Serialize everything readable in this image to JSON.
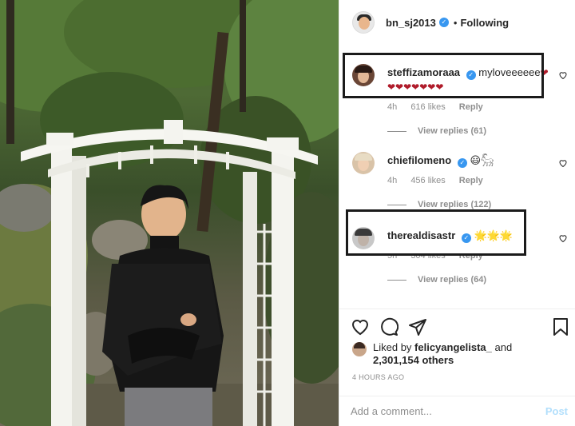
{
  "post": {
    "header": {
      "username": "bn_sj2013",
      "separator": "•",
      "follow_status": "Following",
      "verified_glyph": "✓"
    },
    "comments": [
      {
        "username": "steffizamoraaa",
        "text": "myloveeeeee",
        "trail_emoji": "❤",
        "second_line": "❤❤❤❤❤❤❤",
        "time": "4h",
        "likes": "616 likes",
        "reply": "Reply",
        "view_replies": "View replies (61)",
        "verified": true,
        "highlighted": true
      },
      {
        "username": "chiefilomeno",
        "text": "😃𓃵",
        "time": "4h",
        "likes": "456 likes",
        "reply": "Reply",
        "view_replies": "View replies (122)",
        "verified": true,
        "highlighted": false
      },
      {
        "username": "therealdisastr",
        "text": "🌟🌟🌟",
        "time": "5h",
        "likes": "304 likes",
        "reply": "Reply",
        "view_replies": "View replies (64)",
        "verified": true,
        "highlighted": true
      }
    ],
    "actions": {
      "icons": [
        "heart-icon",
        "comment-icon",
        "share-icon",
        "bookmark-icon"
      ]
    },
    "likes": {
      "prefix": "Liked by",
      "first_liker": "felicyangelista_",
      "conjunction": "and",
      "others_count": "2,301,154 others"
    },
    "timestamp": "4 HOURS AGO",
    "add_comment": {
      "placeholder": "Add a comment...",
      "post_label": "Post"
    }
  },
  "colors": {
    "verified": "#3897f0",
    "muted_text": "#8e8e8e",
    "post_button_disabled": "#b2dffc",
    "heart_red": "#b01c2b",
    "highlight_border": "#1b1b1b"
  }
}
